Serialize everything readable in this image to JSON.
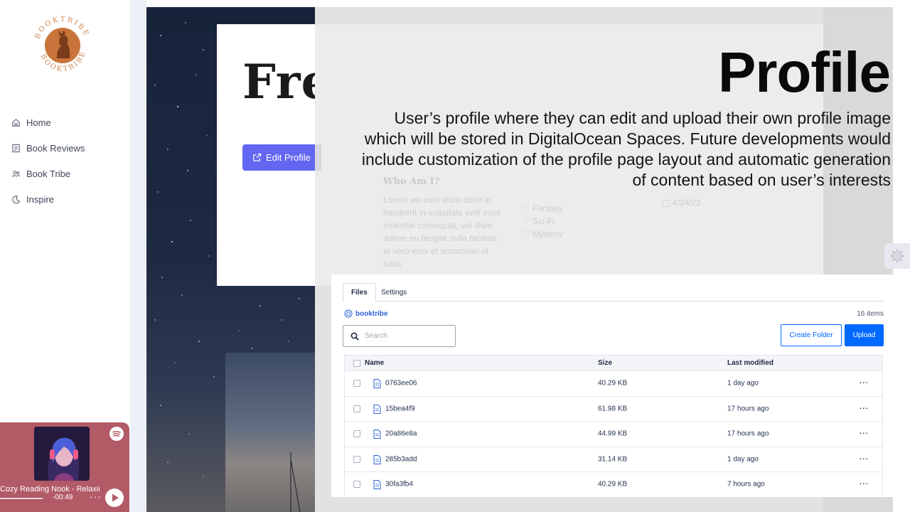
{
  "sidebar": {
    "logo_text": "BOOKTRIBE",
    "items": [
      {
        "label": "Home",
        "icon": "home-icon"
      },
      {
        "label": "Book Reviews",
        "icon": "list-icon"
      },
      {
        "label": "Book Tribe",
        "icon": "users-icon"
      },
      {
        "label": "Inspire",
        "icon": "moon-icon"
      }
    ]
  },
  "player": {
    "track": "Cozy Reading Nook - Relaxing",
    "time_left": "-00:49",
    "more": "···"
  },
  "profile": {
    "name": "Fred",
    "edit_label": "Edit Profile",
    "about_heading": "Who Am I?",
    "about_text": "Lorem vel eum iriure dolor in hendrerit in vulputate velit esse molestie consequat, vel illum dolore eu feugiat nulla facilisis at vero eros et accumsan et iusto",
    "genres": [
      "Fantasy",
      "Sci-Fi",
      "Mystery"
    ],
    "joined": "4/24/23"
  },
  "slide": {
    "title": "Profile",
    "description": "User’s profile where they can edit and upload their own profile image which will be stored in DigitalOcean Spaces. Future developments would include customization of the profile page layout and automatic generation of content based on user’s interests"
  },
  "files": {
    "tabs": [
      "Files",
      "Settings"
    ],
    "bucket": "booktribe",
    "count": "16 items",
    "search_placeholder": "Search",
    "create_folder": "Create Folder",
    "upload": "Upload",
    "columns": {
      "name": "Name",
      "size": "Size",
      "modified": "Last modified"
    },
    "rows": [
      {
        "name": "0763ee06",
        "size": "40.29 KB",
        "modified": "1 day ago",
        "more": "···"
      },
      {
        "name": "15bea4f9",
        "size": "61.98 KB",
        "modified": "17 hours ago",
        "more": "···"
      },
      {
        "name": "20a86e8a",
        "size": "44.99 KB",
        "modified": "17 hours ago",
        "more": "···"
      },
      {
        "name": "285b3add",
        "size": "31.14 KB",
        "modified": "1 day ago",
        "more": "···"
      },
      {
        "name": "30fa3fb4",
        "size": "40.29 KB",
        "modified": "7 hours ago",
        "more": "···"
      }
    ]
  },
  "colors": {
    "accent": "#6366f1",
    "do_blue": "#0069ff",
    "player": "#b35a67",
    "logo": "#c8743a"
  }
}
